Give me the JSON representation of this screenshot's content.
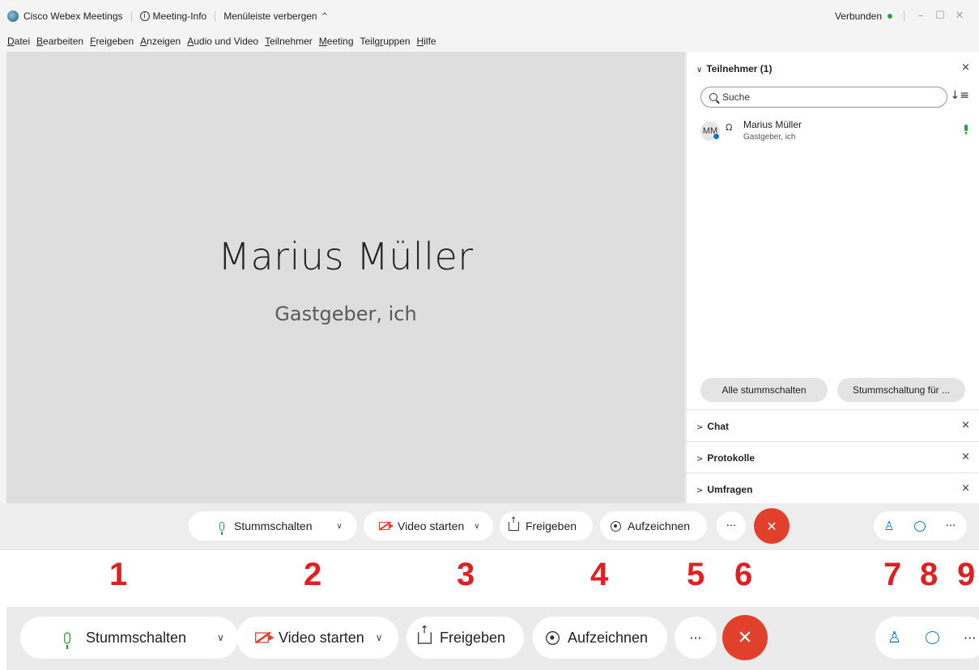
{
  "titlebar": {
    "app_name": "Cisco Webex Meetings",
    "meeting_info": "Meeting-Info",
    "hide_menu": "Menüleiste verbergen",
    "status": "Verbunden",
    "minimize": "–",
    "maximize": "☐",
    "close": "✕"
  },
  "menubar": {
    "items": [
      {
        "u": "D",
        "rest": "atei"
      },
      {
        "u": "B",
        "rest": "earbeiten"
      },
      {
        "u": "F",
        "rest": "reigeben"
      },
      {
        "u": "A",
        "rest": "nzeigen"
      },
      {
        "u": "A",
        "rest": "udio und Video"
      },
      {
        "u": "T",
        "rest": "eilnehmer"
      },
      {
        "u": "M",
        "rest": "eeting"
      },
      {
        "pre": "Teilg",
        "u": "r",
        "rest": "uppen"
      },
      {
        "u": "H",
        "rest": "ilfe"
      }
    ]
  },
  "stage": {
    "name": "Marius Müller",
    "role": "Gastgeber, ich"
  },
  "panel": {
    "participants_title": "Teilnehmer (1)",
    "search_placeholder": "Suche",
    "participant": {
      "initials": "MM",
      "name": "Marius Müller",
      "role": "Gastgeber, ich"
    },
    "mute_all": "Alle stummschalten",
    "unmute_all": "Stummschaltung für ...",
    "sections": [
      "Chat",
      "Protokolle",
      "Umfragen"
    ]
  },
  "toolbar": {
    "mute": "Stummschalten",
    "video": "Video starten",
    "share": "Freigeben",
    "record": "Aufzeichnen",
    "more": "···",
    "end": "✕"
  },
  "annotation_numbers": [
    "1",
    "2",
    "3",
    "4",
    "5",
    "6",
    "7",
    "8",
    "9"
  ],
  "colors": {
    "end_red": "#e0402c",
    "accent_blue": "#0b76c8",
    "mic_green": "#2f9e44",
    "annotation_red": "#e02020"
  }
}
